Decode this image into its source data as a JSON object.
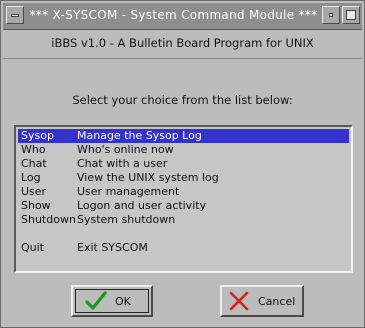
{
  "window": {
    "title": "*** X-SYSCOM - System Command Module ***",
    "subtitle": "iBBS v1.0 - A Bulletin Board Program for UNIX",
    "prompt": "Select your choice from the list below:"
  },
  "list": {
    "items": [
      {
        "key": "Sysop",
        "desc": "Manage the Sysop Log",
        "selected": true
      },
      {
        "key": "Who",
        "desc": "Who's online now"
      },
      {
        "key": "Chat",
        "desc": "Chat with a user"
      },
      {
        "key": "Log",
        "desc": "View the UNIX system log"
      },
      {
        "key": "User",
        "desc": "User management"
      },
      {
        "key": "Show",
        "desc": "Logon and user activity"
      },
      {
        "key": "Shutdown",
        "desc": "System shutdown"
      },
      {
        "key": "",
        "desc": ""
      },
      {
        "key": "Quit",
        "desc": "Exit SYSCOM"
      }
    ],
    "selected_color": "#3333cc"
  },
  "buttons": {
    "ok_label": "OK",
    "ok_icon": "checkmark-icon",
    "cancel_label": "Cancel",
    "cancel_icon": "x-icon"
  }
}
